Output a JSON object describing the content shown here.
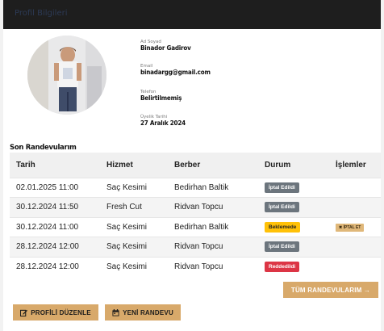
{
  "header": {
    "title": "Profil Bilgileri"
  },
  "profile": {
    "name_label": "Ad Soyad",
    "name": "Binador Gadirov",
    "email_label": "Email",
    "email": "binadargg@gmail.com",
    "phone_label": "Telefon",
    "phone": "Belirtilmemiş",
    "member_since_label": "Üyelik Tarihi",
    "member_since": "27 Aralık 2024"
  },
  "appointments": {
    "title": "Son Randevularım",
    "columns": [
      "Tarih",
      "Hizmet",
      "Berber",
      "Durum",
      "İşlemler"
    ],
    "rows": [
      {
        "date": "02.01.2025 11:00",
        "service": "Saç Kesimi",
        "barber": "Bedirhan Baltik",
        "status": "İptal Edildi",
        "status_color": "#6c757d",
        "action": ""
      },
      {
        "date": "30.12.2024 11:50",
        "service": "Fresh Cut",
        "barber": "Ridvan Topcu",
        "status": "İptal Edildi",
        "status_color": "#6c757d",
        "action": ""
      },
      {
        "date": "30.12.2024 11:00",
        "service": "Saç Kesimi",
        "barber": "Bedirhan Baltik",
        "status": "Beklemede",
        "status_color": "#ffc107",
        "action": "İPTAL ET"
      },
      {
        "date": "28.12.2024 12:00",
        "service": "Saç Kesimi",
        "barber": "Ridvan Topcu",
        "status": "İptal Edildi",
        "status_color": "#6c757d",
        "action": ""
      },
      {
        "date": "28.12.2024 12:00",
        "service": "Saç Kesimi",
        "barber": "Ridvan Topcu",
        "status": "Reddedildi",
        "status_color": "#dc3545",
        "action": ""
      }
    ]
  },
  "actions": {
    "all_appointments": "TÜM RANDEVULARIM →",
    "edit_profile": "PROFİLİ DÜZENLE",
    "new_appointment": "YENİ RANDEVU"
  },
  "colors": {
    "accent": "#d8a96a",
    "topbar": "#1e1e1e"
  },
  "icons": {
    "edit": "edit-icon",
    "calendar": "calendar-icon",
    "cancel": "close-icon"
  }
}
